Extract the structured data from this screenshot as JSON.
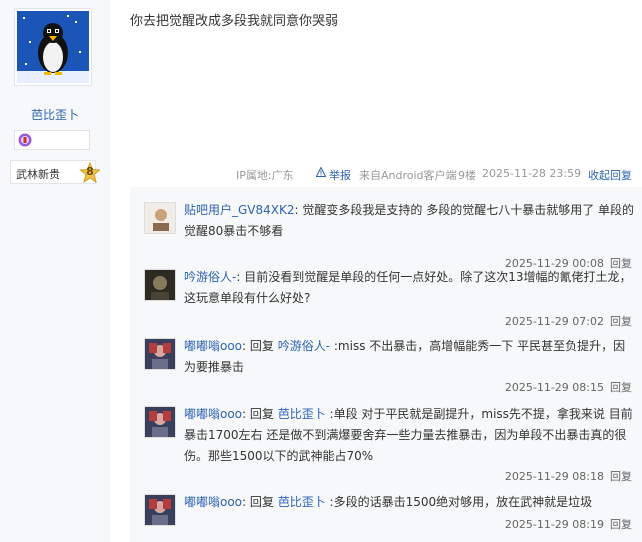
{
  "sidebar": {
    "username": "芭比歪卜",
    "level_title": "武林新贵",
    "level_number": "8"
  },
  "post": {
    "content": "你去把觉醒改成多段我就同意你哭弱",
    "tail": {
      "ip": "IP属地:广东",
      "report": "举报",
      "source": "来自Android客户端",
      "floor": "9楼",
      "time": "2025-11-28 23:59",
      "collapse": "收起回复"
    }
  },
  "replies": [
    {
      "user": "贴吧用户_GV84XK2",
      "prefix": "",
      "target": "",
      "content": ": 觉醒变多段我是支持的 多段的觉醒七八十暴击就够用了 单段的觉醒80暴击不够看",
      "time": "2025-11-29 00:08",
      "reply_label": "回复"
    },
    {
      "user": "吟游俗人-",
      "prefix": "",
      "target": "",
      "content": ": 目前没看到觉醒是单段的任何一点好处。除了这次13增幅的氰佬打土龙，这玩意单段有什么好处?",
      "time": "2025-11-29 07:02",
      "reply_label": "回复"
    },
    {
      "user": "嘟嘟嗡ooo",
      "prefix": ": 回复 ",
      "target": "吟游俗人-",
      "content": " :miss 不出暴击，高增幅能秀一下 平民甚至负提升，因为要推暴击",
      "time": "2025-11-29 08:15",
      "reply_label": "回复"
    },
    {
      "user": "嘟嘟嗡ooo",
      "prefix": ": 回复 ",
      "target": "芭比歪卜",
      "content": " :单段 对于平民就是副提升，miss先不提，拿我来说 目前暴击1700左右 还是做不到满爆要舍弃一些力量去推暴击，因为单段不出暴击真的很伤。那些1500以下的武神能占70%",
      "time": "2025-11-29 08:18",
      "reply_label": "回复"
    },
    {
      "user": "嘟嘟嗡ooo",
      "prefix": ": 回复 ",
      "target": "芭比歪卜",
      "content": " :多段的话暴击1500绝对够用，放在武神就是垃圾",
      "time": "2025-11-29 08:19",
      "reply_label": "回复"
    }
  ]
}
